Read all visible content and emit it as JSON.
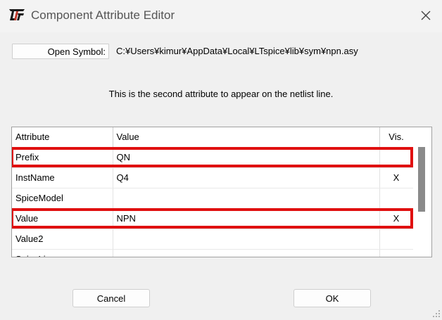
{
  "window": {
    "title": "Component Attribute Editor",
    "icon": "ltspice-logo-icon",
    "close_icon": "close-icon"
  },
  "symbol": {
    "open_label": "Open Symbol:",
    "path": "C:¥Users¥kimur¥AppData¥Local¥LTspice¥lib¥sym¥npn.asy"
  },
  "hint_text": "This is the second attribute to appear on the netlist line.",
  "grid": {
    "headers": {
      "attribute": "Attribute",
      "value": "Value",
      "vis": "Vis."
    },
    "rows": [
      {
        "attribute": "Prefix",
        "value": "QN",
        "vis": "",
        "highlighted": true
      },
      {
        "attribute": "InstName",
        "value": "Q4",
        "vis": "X",
        "highlighted": false
      },
      {
        "attribute": "SpiceModel",
        "value": "",
        "vis": "",
        "highlighted": false
      },
      {
        "attribute": "Value",
        "value": "NPN",
        "vis": "X",
        "highlighted": true
      },
      {
        "attribute": "Value2",
        "value": "",
        "vis": "",
        "highlighted": false
      },
      {
        "attribute": "SpiceLine",
        "value": "",
        "vis": "",
        "highlighted": false
      }
    ]
  },
  "buttons": {
    "cancel": "Cancel",
    "ok": "OK"
  },
  "colors": {
    "highlight": "#e01010",
    "background": "#f0f0f0"
  }
}
